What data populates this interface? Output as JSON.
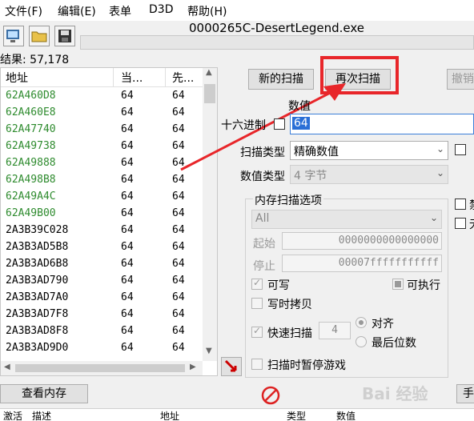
{
  "menu": [
    "文件(F)",
    "编辑(E)",
    "表单",
    "D3D",
    "帮助(H)"
  ],
  "title": "0000265C-DesertLegend.exe",
  "found_count": "结果: 57,178",
  "list": {
    "headers": [
      "地址",
      "当...",
      "先..."
    ],
    "rows": [
      {
        "addr": "62A460D8",
        "cur": "64",
        "prev": "64",
        "color": "#2e8b2e"
      },
      {
        "addr": "62A460E8",
        "cur": "64",
        "prev": "64",
        "color": "#2e8b2e"
      },
      {
        "addr": "62A47740",
        "cur": "64",
        "prev": "64",
        "color": "#2e8b2e"
      },
      {
        "addr": "62A49738",
        "cur": "64",
        "prev": "64",
        "color": "#2e8b2e"
      },
      {
        "addr": "62A49888",
        "cur": "64",
        "prev": "64",
        "color": "#2e8b2e"
      },
      {
        "addr": "62A498B8",
        "cur": "64",
        "prev": "64",
        "color": "#2e8b2e"
      },
      {
        "addr": "62A49A4C",
        "cur": "64",
        "prev": "64",
        "color": "#2e8b2e"
      },
      {
        "addr": "62A49B00",
        "cur": "64",
        "prev": "64",
        "color": "#2e8b2e"
      },
      {
        "addr": "2A3B39C028",
        "cur": "64",
        "prev": "64",
        "color": "#000000"
      },
      {
        "addr": "2A3B3AD5B8",
        "cur": "64",
        "prev": "64",
        "color": "#000000"
      },
      {
        "addr": "2A3B3AD6B8",
        "cur": "64",
        "prev": "64",
        "color": "#000000"
      },
      {
        "addr": "2A3B3AD790",
        "cur": "64",
        "prev": "64",
        "color": "#000000"
      },
      {
        "addr": "2A3B3AD7A0",
        "cur": "64",
        "prev": "64",
        "color": "#000000"
      },
      {
        "addr": "2A3B3AD7F8",
        "cur": "64",
        "prev": "64",
        "color": "#000000"
      },
      {
        "addr": "2A3B3AD8F8",
        "cur": "64",
        "prev": "64",
        "color": "#000000"
      },
      {
        "addr": "2A3B3AD9D0",
        "cur": "64",
        "prev": "64",
        "color": "#000000"
      }
    ]
  },
  "buttons": {
    "new_scan": "新的扫描",
    "next_scan": "再次扫描",
    "undo": "撤销",
    "view_memory": "查看内存"
  },
  "value": {
    "label": "数值",
    "hex_label": "十六进制",
    "input": "64"
  },
  "scan_type": {
    "label": "扫描类型",
    "value": "精确数值"
  },
  "value_type": {
    "label": "数值类型",
    "value": "4 字节"
  },
  "mem_options": {
    "title": "内存扫描选项",
    "region": "All",
    "start_label": "起始",
    "start": "0000000000000000",
    "stop_label": "停止",
    "stop": "00007fffffffffff",
    "writable": "可写",
    "executable": "可执行",
    "cow": "写时拷贝",
    "fast_scan": "快速扫描",
    "fast_value": "4",
    "align": "对齐",
    "last_digits": "最后位数",
    "pause": "扫描时暂停游戏"
  },
  "bottom_headers": [
    "激活",
    "描述",
    "地址",
    "类型",
    "数值"
  ],
  "right_cut": {
    "btn": "手",
    "cb1_char": "禁",
    "cb2_char": "无"
  },
  "accent": "#e8262a",
  "watermark": "Bai 经验"
}
